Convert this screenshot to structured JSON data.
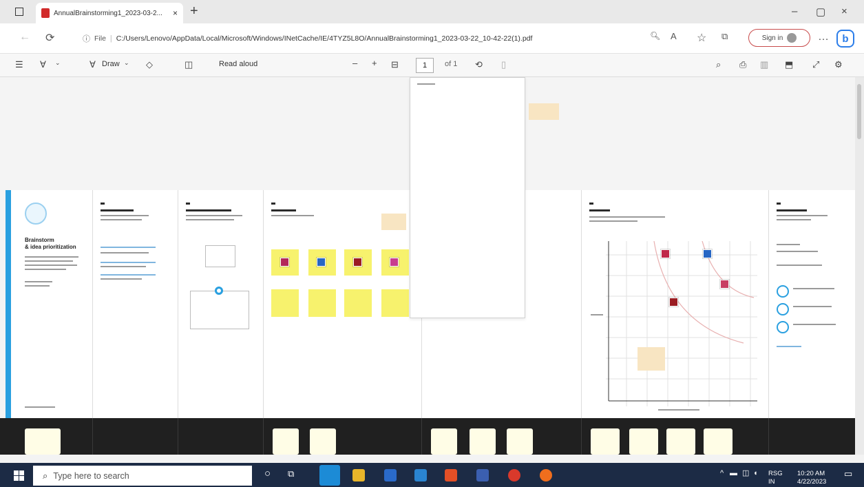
{
  "browser": {
    "tab_title": "AnnualBrainstorming1_2023-03-2...",
    "new_tab": "+",
    "url_prefix": "File",
    "url": "C:/Users/Lenovo/AppData/Local/Microsoft/Windows/INetCache/IE/4TYZ5L8O/AnnualBrainstorming1_2023-03-22_10-42-22(1).pdf",
    "sign_in": "Sign in",
    "window_controls": {
      "minimize": "–",
      "maximize": "▢",
      "close": "×"
    }
  },
  "pdf_toolbar": {
    "draw_label": "Draw",
    "read_aloud_label": "Read aloud",
    "zoom_out": "–",
    "zoom_in": "+",
    "page_number": "1",
    "page_total": "of 1"
  },
  "board": {
    "title_line1": "Brainstorm",
    "title_line2": "& idea prioritization"
  },
  "taskbar": {
    "search_placeholder": "Type here to search",
    "weather": "RSG",
    "time": "10:20 AM",
    "lang": "IN",
    "date": "4/22/2023"
  },
  "colors": {
    "accent_blue": "#2aa0e0",
    "sticky_yellow": "#f7f26d",
    "taskbar": "#1c2b45",
    "signin_border": "#c84b4b"
  }
}
